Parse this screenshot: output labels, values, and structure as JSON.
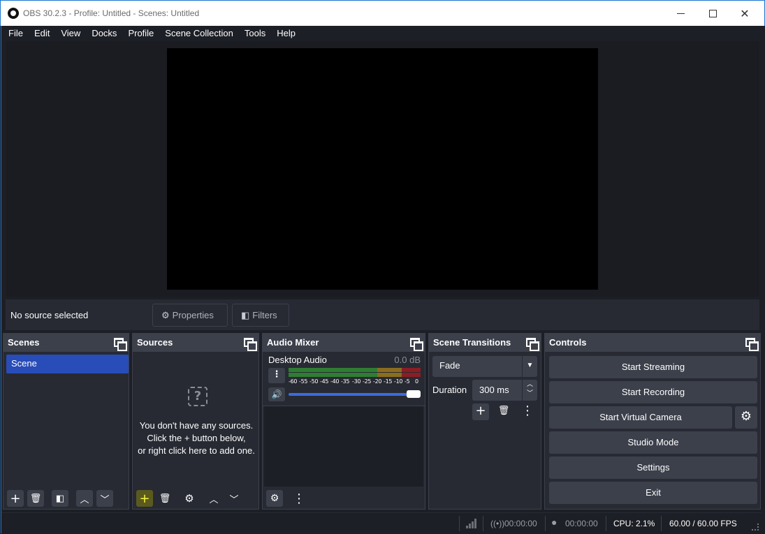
{
  "window": {
    "title": "OBS 30.2.3 - Profile: Untitled - Scenes: Untitled"
  },
  "menu": [
    "File",
    "Edit",
    "View",
    "Docks",
    "Profile",
    "Scene Collection",
    "Tools",
    "Help"
  ],
  "context_bar": {
    "status": "No source selected",
    "properties_label": "Properties",
    "filters_label": "Filters"
  },
  "scenes": {
    "title": "Scenes",
    "items": [
      "Scene"
    ]
  },
  "sources": {
    "title": "Sources",
    "empty_lines": [
      "You don't have any sources.",
      "Click the + button below,",
      "or right click here to add one."
    ]
  },
  "audio_mixer": {
    "title": "Audio Mixer",
    "channel": {
      "name": "Desktop Audio",
      "level": "0.0 dB"
    },
    "ticks": [
      "-60",
      "-55",
      "-50",
      "-45",
      "-40",
      "-35",
      "-30",
      "-25",
      "-20",
      "-15",
      "-10",
      "-5",
      "0"
    ],
    "volume_fraction": 1.0
  },
  "transitions": {
    "title": "Scene Transitions",
    "selected": "Fade",
    "duration_label": "Duration",
    "duration_value": "300 ms"
  },
  "controls": {
    "title": "Controls",
    "buttons": [
      "Start Streaming",
      "Start Recording",
      "Start Virtual Camera",
      "Studio Mode",
      "Settings",
      "Exit"
    ]
  },
  "status": {
    "stream_time": "00:00:00",
    "record_time": "00:00:00",
    "cpu": "CPU: 2.1%",
    "fps": "60.00 / 60.00 FPS"
  },
  "colors": {
    "accent": "#284cb8",
    "highlight_button": "#f5f542",
    "panel": "#272a33",
    "header": "#3c404b"
  }
}
